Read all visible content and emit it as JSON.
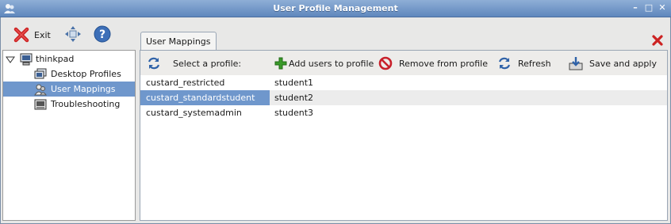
{
  "window": {
    "title": "User Profile Management"
  },
  "toolbar": {
    "exit_label": "Exit",
    "move_icon": "move-arrows-icon",
    "help_icon": "help-icon"
  },
  "tree": {
    "root": "thinkpad",
    "items": [
      {
        "label": "Desktop Profiles",
        "icon": "desktop-profiles-icon",
        "selected": false
      },
      {
        "label": "User Mappings",
        "icon": "user-mappings-icon",
        "selected": true
      },
      {
        "label": "Troubleshooting",
        "icon": "troubleshooting-icon",
        "selected": false
      }
    ]
  },
  "tab": {
    "label": "User Mappings"
  },
  "panel_toolbar": {
    "select_profile_label": "Select a profile:",
    "add_label": "Add users to profile",
    "remove_label": "Remove from profile",
    "refresh_label": "Refresh",
    "save_label": "Save and apply"
  },
  "mappings": [
    {
      "profile": "custard_restricted",
      "user": "student1",
      "selected": false
    },
    {
      "profile": "custard_standardstudent",
      "user": "student2",
      "selected": true
    },
    {
      "profile": "custard_systemadmin",
      "user": "student3",
      "selected": false
    }
  ],
  "colors": {
    "titlebar": "#6f92c4",
    "selection": "#6f97cc",
    "exit_red": "#cc2222",
    "add_green": "#3a9a2a"
  }
}
